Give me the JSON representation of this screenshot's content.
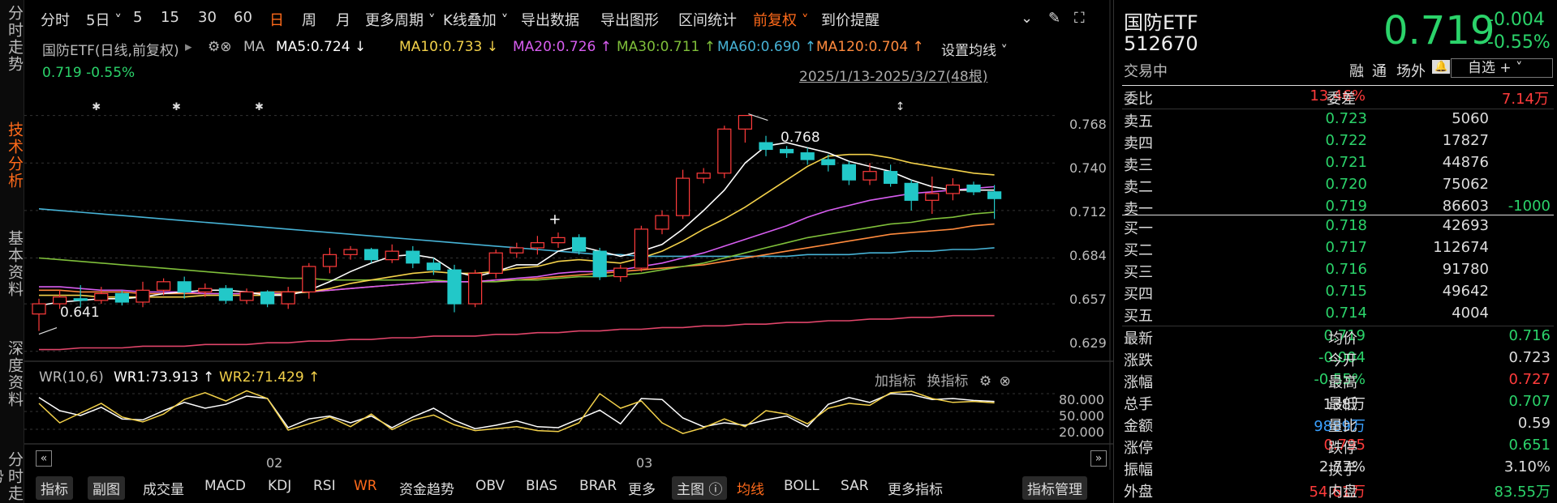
{
  "leftnav": [
    "分时走势",
    "技术分析",
    "基本资料",
    "深度资料",
    "分时走势"
  ],
  "toolbar": {
    "items": [
      "分时",
      "5日 ˅",
      "5",
      "15",
      "30",
      "60",
      "日",
      "周",
      "月",
      "更多周期 ˅",
      "K线叠加 ˅",
      "导出数据",
      "导出图形",
      "区间统计",
      "前复权 ˅",
      "到价提醒"
    ],
    "active": "日",
    "active2": "前复权 ˅"
  },
  "legend": {
    "title": "国防ETF(日线,前复权)",
    "ma_label": "MA",
    "ma5": "MA5:0.724 ↓",
    "ma10": "MA10:0.733 ↓",
    "ma20": "MA20:0.726 ↑",
    "ma30": "MA30:0.711 ↑",
    "ma60": "MA60:0.690 ↑",
    "ma120": "MA120:0.704 ↑",
    "set_ma": "设置均线 ˅",
    "price_tag": "0.719 -0.55%",
    "range": "2025/1/13-2025/3/27(48根)"
  },
  "colors": {
    "up": "#ff3b3b",
    "down": "#22c8c8",
    "ma5": "#ffffff",
    "ma10": "#f3d14a",
    "ma20": "#d75df0",
    "ma30": "#7fbf3a",
    "ma60": "#47b3d6",
    "ma120": "#ff8a3d",
    "long": "#e0456a",
    "green": "#2bd36a"
  },
  "chart_data": {
    "type": "candlestick",
    "yticks": [
      "0.768",
      "0.740",
      "0.712",
      "0.684",
      "0.657",
      "0.629"
    ],
    "high_mark": "0.768",
    "low_mark": "0.641",
    "ylim": [
      0.626,
      0.774
    ],
    "candles": [
      [
        0.651,
        0.657,
        0.641,
        0.66
      ],
      [
        0.657,
        0.661,
        0.654,
        0.665
      ],
      [
        0.66,
        0.659,
        0.655,
        0.668
      ],
      [
        0.659,
        0.663,
        0.657,
        0.667
      ],
      [
        0.663,
        0.658,
        0.656,
        0.665
      ],
      [
        0.658,
        0.665,
        0.655,
        0.67
      ],
      [
        0.665,
        0.67,
        0.662,
        0.672
      ],
      [
        0.67,
        0.664,
        0.66,
        0.673
      ],
      [
        0.664,
        0.666,
        0.661,
        0.669
      ],
      [
        0.666,
        0.659,
        0.657,
        0.668
      ],
      [
        0.659,
        0.664,
        0.657,
        0.666
      ],
      [
        0.664,
        0.657,
        0.655,
        0.665
      ],
      [
        0.657,
        0.664,
        0.654,
        0.667
      ],
      [
        0.664,
        0.679,
        0.66,
        0.681
      ],
      [
        0.679,
        0.686,
        0.675,
        0.69
      ],
      [
        0.686,
        0.689,
        0.683,
        0.691
      ],
      [
        0.689,
        0.683,
        0.681,
        0.69
      ],
      [
        0.683,
        0.688,
        0.681,
        0.692
      ],
      [
        0.688,
        0.681,
        0.678,
        0.691
      ],
      [
        0.681,
        0.677,
        0.674,
        0.684
      ],
      [
        0.677,
        0.657,
        0.652,
        0.68
      ],
      [
        0.657,
        0.675,
        0.655,
        0.677
      ],
      [
        0.675,
        0.687,
        0.672,
        0.689
      ],
      [
        0.687,
        0.69,
        0.684,
        0.693
      ],
      [
        0.69,
        0.693,
        0.686,
        0.697
      ],
      [
        0.693,
        0.696,
        0.69,
        0.699
      ],
      [
        0.696,
        0.688,
        0.686,
        0.698
      ],
      [
        0.688,
        0.673,
        0.671,
        0.69
      ],
      [
        0.673,
        0.678,
        0.67,
        0.68
      ],
      [
        0.678,
        0.701,
        0.676,
        0.703
      ],
      [
        0.701,
        0.709,
        0.698,
        0.712
      ],
      [
        0.709,
        0.731,
        0.707,
        0.736
      ],
      [
        0.731,
        0.734,
        0.728,
        0.737
      ],
      [
        0.734,
        0.76,
        0.731,
        0.762
      ],
      [
        0.76,
        0.768,
        0.752,
        0.768
      ],
      [
        0.752,
        0.748,
        0.744,
        0.756
      ],
      [
        0.748,
        0.746,
        0.743,
        0.75
      ],
      [
        0.746,
        0.742,
        0.739,
        0.749
      ],
      [
        0.742,
        0.739,
        0.735,
        0.745
      ],
      [
        0.739,
        0.73,
        0.727,
        0.741
      ],
      [
        0.73,
        0.735,
        0.727,
        0.74
      ],
      [
        0.735,
        0.728,
        0.726,
        0.739
      ],
      [
        0.728,
        0.718,
        0.712,
        0.73
      ],
      [
        0.718,
        0.722,
        0.71,
        0.732
      ],
      [
        0.722,
        0.727,
        0.718,
        0.731
      ],
      [
        0.727,
        0.723,
        0.721,
        0.729
      ],
      [
        0.723,
        0.719,
        0.707,
        0.727
      ]
    ],
    "ma5": [
      0.656,
      0.658,
      0.659,
      0.66,
      0.66,
      0.661,
      0.663,
      0.664,
      0.665,
      0.665,
      0.664,
      0.662,
      0.662,
      0.665,
      0.67,
      0.676,
      0.681,
      0.685,
      0.686,
      0.684,
      0.676,
      0.673,
      0.676,
      0.68,
      0.68,
      0.688,
      0.691,
      0.688,
      0.685,
      0.688,
      0.692,
      0.701,
      0.712,
      0.724,
      0.74,
      0.75,
      0.752,
      0.749,
      0.746,
      0.741,
      0.738,
      0.735,
      0.73,
      0.726,
      0.724,
      0.724,
      0.724
    ],
    "ma10": [
      0.662,
      0.662,
      0.662,
      0.661,
      0.661,
      0.661,
      0.661,
      0.661,
      0.662,
      0.662,
      0.662,
      0.662,
      0.663,
      0.664,
      0.666,
      0.669,
      0.671,
      0.673,
      0.675,
      0.676,
      0.675,
      0.675,
      0.676,
      0.678,
      0.679,
      0.682,
      0.683,
      0.682,
      0.681,
      0.684,
      0.688,
      0.694,
      0.701,
      0.707,
      0.714,
      0.722,
      0.73,
      0.738,
      0.744,
      0.745,
      0.745,
      0.743,
      0.74,
      0.738,
      0.736,
      0.734,
      0.733
    ],
    "ma20": [
      0.667,
      0.667,
      0.666,
      0.665,
      0.665,
      0.664,
      0.664,
      0.664,
      0.663,
      0.663,
      0.663,
      0.663,
      0.663,
      0.664,
      0.665,
      0.666,
      0.667,
      0.668,
      0.669,
      0.67,
      0.67,
      0.67,
      0.671,
      0.672,
      0.673,
      0.675,
      0.676,
      0.676,
      0.677,
      0.679,
      0.681,
      0.684,
      0.687,
      0.691,
      0.695,
      0.699,
      0.703,
      0.708,
      0.712,
      0.715,
      0.718,
      0.72,
      0.722,
      0.723,
      0.724,
      0.725,
      0.726
    ],
    "ma30": [
      0.684,
      0.683,
      0.682,
      0.681,
      0.68,
      0.679,
      0.678,
      0.677,
      0.676,
      0.675,
      0.674,
      0.673,
      0.672,
      0.672,
      0.671,
      0.671,
      0.671,
      0.671,
      0.671,
      0.671,
      0.67,
      0.67,
      0.67,
      0.671,
      0.671,
      0.672,
      0.673,
      0.673,
      0.674,
      0.675,
      0.677,
      0.679,
      0.681,
      0.684,
      0.687,
      0.69,
      0.693,
      0.696,
      0.698,
      0.7,
      0.702,
      0.704,
      0.705,
      0.707,
      0.708,
      0.71,
      0.711
    ],
    "ma60": [
      0.713,
      0.712,
      0.711,
      0.71,
      0.709,
      0.708,
      0.707,
      0.706,
      0.705,
      0.704,
      0.703,
      0.702,
      0.701,
      0.7,
      0.699,
      0.698,
      0.697,
      0.696,
      0.695,
      0.694,
      0.693,
      0.692,
      0.691,
      0.69,
      0.689,
      0.688,
      0.687,
      0.686,
      0.686,
      0.685,
      0.685,
      0.685,
      0.685,
      0.685,
      0.685,
      0.685,
      0.685,
      0.686,
      0.686,
      0.686,
      0.687,
      0.687,
      0.688,
      0.688,
      0.689,
      0.689,
      0.69
    ],
    "ma120": [
      0.665,
      0.665,
      0.664,
      0.664,
      0.664,
      0.663,
      0.663,
      0.663,
      0.663,
      0.663,
      0.663,
      0.664,
      0.664,
      0.664,
      0.665,
      0.666,
      0.667,
      0.668,
      0.669,
      0.67,
      0.67,
      0.67,
      0.671,
      0.671,
      0.672,
      0.673,
      0.674,
      0.675,
      0.676,
      0.677,
      0.678,
      0.679,
      0.68,
      0.682,
      0.684,
      0.686,
      0.688,
      0.69,
      0.692,
      0.694,
      0.696,
      0.698,
      0.699,
      0.7,
      0.701,
      0.703,
      0.704
    ],
    "long": [
      0.63,
      0.63,
      0.631,
      0.631,
      0.631,
      0.632,
      0.632,
      0.632,
      0.633,
      0.633,
      0.633,
      0.634,
      0.634,
      0.635,
      0.635,
      0.636,
      0.636,
      0.637,
      0.637,
      0.638,
      0.638,
      0.638,
      0.639,
      0.639,
      0.64,
      0.64,
      0.641,
      0.641,
      0.642,
      0.642,
      0.643,
      0.643,
      0.644,
      0.644,
      0.645,
      0.645,
      0.646,
      0.646,
      0.647,
      0.647,
      0.648,
      0.648,
      0.649,
      0.649,
      0.65,
      0.65,
      0.65
    ]
  },
  "wr": {
    "title": "WR(10,6)",
    "wr1": "WR1:73.913 ↑",
    "wr2": "WR2:71.429 ↑",
    "tools": [
      "加指标",
      "换指标"
    ],
    "yticks": [
      "80.000",
      "50.000",
      "20.000"
    ],
    "wr1_values": [
      82,
      55,
      45,
      62,
      38,
      36,
      55,
      72,
      60,
      68,
      85,
      80,
      20,
      38,
      44,
      30,
      44,
      20,
      42,
      60,
      35,
      18,
      25,
      34,
      22,
      20,
      38,
      56,
      28,
      80,
      78,
      40,
      22,
      30,
      25,
      36,
      44,
      22,
      68,
      82,
      72,
      90,
      88,
      78,
      80,
      76,
      74
    ],
    "wr2_values": [
      70,
      30,
      50,
      70,
      42,
      32,
      48,
      78,
      92,
      75,
      96,
      80,
      15,
      28,
      42,
      22,
      48,
      16,
      36,
      46,
      26,
      14,
      18,
      22,
      14,
      12,
      30,
      90,
      60,
      75,
      30,
      8,
      20,
      38,
      22,
      55,
      48,
      28,
      60,
      70,
      66,
      92,
      95,
      80,
      72,
      74,
      71
    ]
  },
  "dates": [
    "02",
    "03"
  ],
  "bottombar": {
    "items": [
      "指标",
      "副图",
      "成交量",
      "MACD",
      "KDJ",
      "RSI",
      "WR",
      "资金趋势",
      "OBV",
      "BIAS",
      "BRAR",
      "更多",
      "主图 ⓘ",
      "均线",
      "BOLL",
      "SAR",
      "更多指标",
      "指标管理"
    ]
  },
  "rp": {
    "name": "国防ETF",
    "code": "512670",
    "status": "交易中",
    "price": "0.719",
    "chg": "-0.004",
    "pct": "-0.55%",
    "tags": [
      "融",
      "通",
      "场外"
    ],
    "zixuan": "自选 + ˅",
    "weibi_label": "委比",
    "weibi": "13.46%",
    "weicha_label": "委差",
    "weicha": "7.14万",
    "asks": [
      {
        "label": "卖五",
        "price": "0.723",
        "vol": "5060",
        "chg": ""
      },
      {
        "label": "卖四",
        "price": "0.722",
        "vol": "17827",
        "chg": ""
      },
      {
        "label": "卖三",
        "price": "0.721",
        "vol": "44876",
        "chg": ""
      },
      {
        "label": "卖二",
        "price": "0.720",
        "vol": "75062",
        "chg": ""
      },
      {
        "label": "卖一",
        "price": "0.719",
        "vol": "86603",
        "chg": "-1000"
      }
    ],
    "bids": [
      {
        "label": "买一",
        "price": "0.718",
        "vol": "42693"
      },
      {
        "label": "买二",
        "price": "0.717",
        "vol": "112674"
      },
      {
        "label": "买三",
        "price": "0.716",
        "vol": "91780"
      },
      {
        "label": "买四",
        "price": "0.715",
        "vol": "49642"
      },
      {
        "label": "买五",
        "price": "0.714",
        "vol": "4004"
      }
    ],
    "stats": [
      {
        "l1": "最新",
        "v1": "0.719",
        "c1": "g",
        "l2": "均价",
        "v2": "0.716",
        "c2": "g"
      },
      {
        "l1": "涨跌",
        "v1": "-0.004",
        "c1": "g",
        "l2": "今开",
        "v2": "0.723",
        "c2": "w"
      },
      {
        "l1": "涨幅",
        "v1": "-0.55%",
        "c1": "g",
        "l2": "最高",
        "v2": "0.727",
        "c2": "r"
      },
      {
        "l1": "总手",
        "v1": "138万",
        "c1": "w",
        "l2": "最低",
        "v2": "0.707",
        "c2": "g"
      },
      {
        "l1": "金额",
        "v1": "9889万",
        "c1": "b",
        "l2": "量比",
        "v2": "0.59",
        "c2": "w"
      },
      {
        "l1": "涨停",
        "v1": "0.795",
        "c1": "r",
        "l2": "跌停",
        "v2": "0.651",
        "c2": "g"
      },
      {
        "l1": "振幅",
        "v1": "2.77%",
        "c1": "w",
        "l2": "换手",
        "v2": "3.10%",
        "c2": "w"
      },
      {
        "l1": "外盘",
        "v1": "54.61万",
        "c1": "r",
        "l2": "内盘",
        "v2": "83.55万",
        "c2": "g"
      }
    ]
  }
}
